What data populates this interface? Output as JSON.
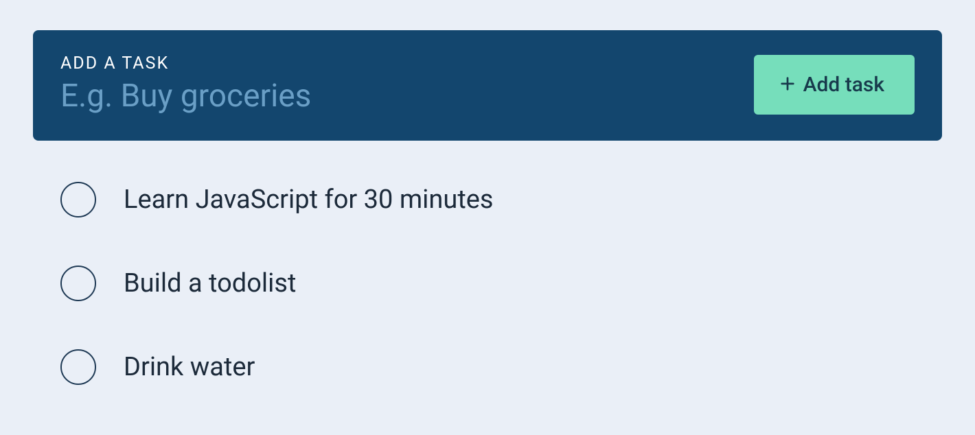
{
  "add_panel": {
    "label": "Add a task",
    "placeholder": "E.g. Buy groceries",
    "value": "",
    "button_label": "Add task"
  },
  "tasks": [
    {
      "label": "Learn JavaScript for 30 minutes",
      "done": false
    },
    {
      "label": "Build a todolist",
      "done": false
    },
    {
      "label": "Drink water",
      "done": false
    }
  ]
}
